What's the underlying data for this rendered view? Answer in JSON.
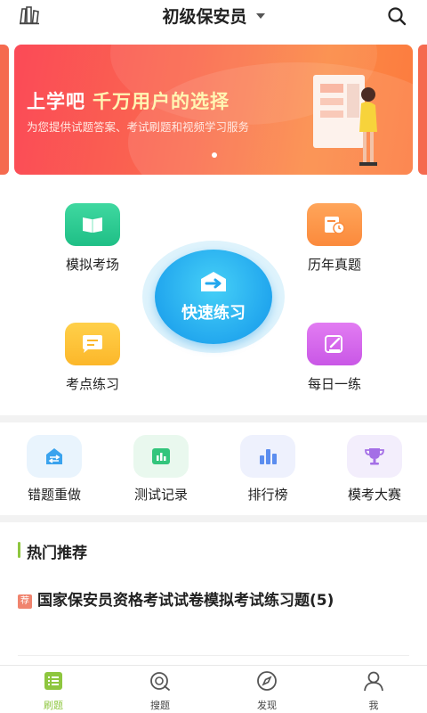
{
  "header": {
    "title": "初级保安员"
  },
  "banner": {
    "headline_part1": "上学吧",
    "headline_part2": "千万用户的选择",
    "subtitle": "为您提供试题答案、考试刷题和视频学习服务"
  },
  "quick": {
    "mock_exam": "模拟考场",
    "past_papers": "历年真题",
    "quick_practice": "快速练习",
    "point_practice": "考点练习",
    "daily_practice": "每日一练"
  },
  "tools": [
    {
      "label": "错题重做",
      "icon": "redo-icon",
      "bg": "#e9f4fd"
    },
    {
      "label": "测试记录",
      "icon": "chart-icon",
      "bg": "#e9f8ee"
    },
    {
      "label": "排行榜",
      "icon": "ranking-icon",
      "bg": "#eef1fd"
    },
    {
      "label": "模考大赛",
      "icon": "trophy-icon",
      "bg": "#f3eefc"
    }
  ],
  "hot": {
    "section_title": "热门推荐",
    "tag": "荐",
    "item_title": "国家保安员资格考试试卷模拟考试练习题(5)"
  },
  "nav": [
    {
      "label": "刷题",
      "icon": "practice-icon"
    },
    {
      "label": "搜题",
      "icon": "search-question-icon"
    },
    {
      "label": "发现",
      "icon": "compass-icon"
    },
    {
      "label": "我",
      "icon": "user-icon"
    }
  ],
  "colors": {
    "accent_green": "#8ec63f",
    "banner_red": "#fb4a57",
    "banner_orange": "#fc7a3f",
    "center_blue": "#22a7ee"
  }
}
